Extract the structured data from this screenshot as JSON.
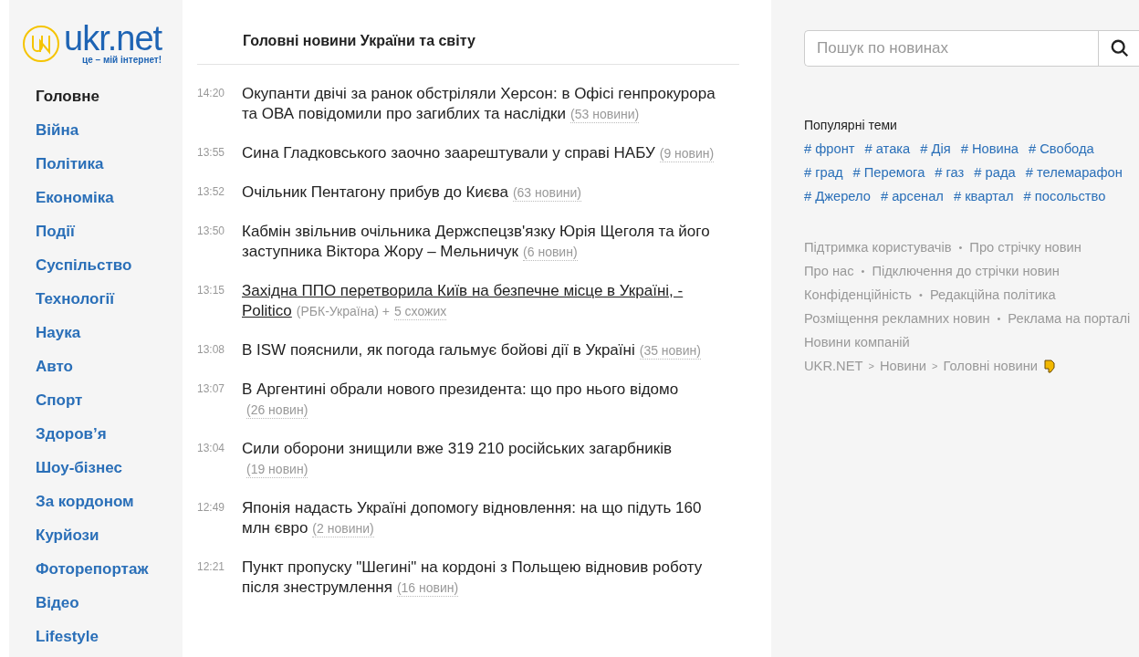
{
  "logo": {
    "name": "ukr.net",
    "tagline": "це – мій інтернет!"
  },
  "nav": [
    {
      "label": "Головне",
      "selected": true
    },
    {
      "label": "Війна",
      "selected": false
    },
    {
      "label": "Політика",
      "selected": false
    },
    {
      "label": "Економіка",
      "selected": false
    },
    {
      "label": "Події",
      "selected": false
    },
    {
      "label": "Суспільство",
      "selected": false
    },
    {
      "label": "Технології",
      "selected": false
    },
    {
      "label": "Наука",
      "selected": false
    },
    {
      "label": "Авто",
      "selected": false
    },
    {
      "label": "Спорт",
      "selected": false
    },
    {
      "label": "Здоров’я",
      "selected": false
    },
    {
      "label": "Шоу-бізнес",
      "selected": false
    },
    {
      "label": "За кордоном",
      "selected": false
    },
    {
      "label": "Курйози",
      "selected": false
    },
    {
      "label": "Фоторепортаж",
      "selected": false
    },
    {
      "label": "Відео",
      "selected": false
    },
    {
      "label": "Lifestyle",
      "selected": false
    }
  ],
  "heading": "Головні новини України та світу",
  "news": [
    {
      "time": "14:20",
      "title": "Окупанти двічі за ранок обстріляли Херсон: в Офісі генпрокурора та ОВА повідомили про загиблих та наслідки",
      "count": "(53 новини)",
      "hovered": false
    },
    {
      "time": "13:55",
      "title": "Сина Гладковського заочно заарештували у справі НАБУ",
      "count": "(9 новин)",
      "hovered": false
    },
    {
      "time": "13:52",
      "title": "Очільник Пентагону прибув до Києва",
      "count": "(63 новини)",
      "hovered": false
    },
    {
      "time": "13:50",
      "title": "Кабмін звільнив очільника Держспецзв'язку Юрія Щеголя та його заступника Віктора Жору – Мельничук",
      "count": "(6 новин)",
      "hovered": false
    },
    {
      "time": "13:15",
      "title": "Західна ППО перетворила Київ на безпечне місце в Україні, - Politico",
      "source": "(РБК-Україна) +",
      "similar": "5 схожих",
      "hovered": true
    },
    {
      "time": "13:08",
      "title": "В ISW пояснили, як погода гальмує бойові дії в Україні",
      "count": "(35 новин)",
      "hovered": false
    },
    {
      "time": "13:07",
      "title": "В Аргентині обрали нового президента: що про нього відомо",
      "count": "(26 новин)",
      "hovered": false
    },
    {
      "time": "13:04",
      "title": "Сили оборони знищили вже 319 210 російських загарбників",
      "count": "(19 новин)",
      "hovered": false
    },
    {
      "time": "12:49",
      "title": "Японія надасть Україні допомогу відновлення: на що підуть 160 млн євро",
      "count": "(2 новини)",
      "hovered": false
    },
    {
      "time": "12:21",
      "title": "Пункт пропуску \"Шегині\" на кордоні з Польщею відновив роботу після знеструмлення",
      "count": "(16 новин)",
      "hovered": false
    }
  ],
  "search": {
    "placeholder": "Пошук по новинах"
  },
  "popular": {
    "title": "Популярні теми",
    "tags": [
      "# фронт",
      "# атака",
      "# Дія",
      "# Новина",
      "# Свобода",
      "# град",
      "# Перемога",
      "# газ",
      "# рада",
      "# телемарафон",
      "# Джерело",
      "# арсенал",
      "# квартал",
      "# посольство"
    ]
  },
  "footer": [
    {
      "links": [
        "Підтримка користувачів",
        "Про стрічку новин"
      ],
      "separator": "•"
    },
    {
      "links": [
        "Про нас",
        "Підключення до стрічки новин"
      ],
      "separator": "•"
    },
    {
      "links": [
        "Конфіденційність",
        "Редакційна політика"
      ],
      "separator": "•"
    },
    {
      "links": [
        "Розміщення рекламних новин",
        "Реклама на порталі"
      ],
      "separator": "•"
    },
    {
      "links": [
        "Новини компаній"
      ]
    }
  ],
  "breadcrumb": [
    {
      "label": "UKR.NET"
    },
    {
      "label": "Новини",
      "separator": ">"
    },
    {
      "label": "Головні новини",
      "separator": ">"
    }
  ]
}
